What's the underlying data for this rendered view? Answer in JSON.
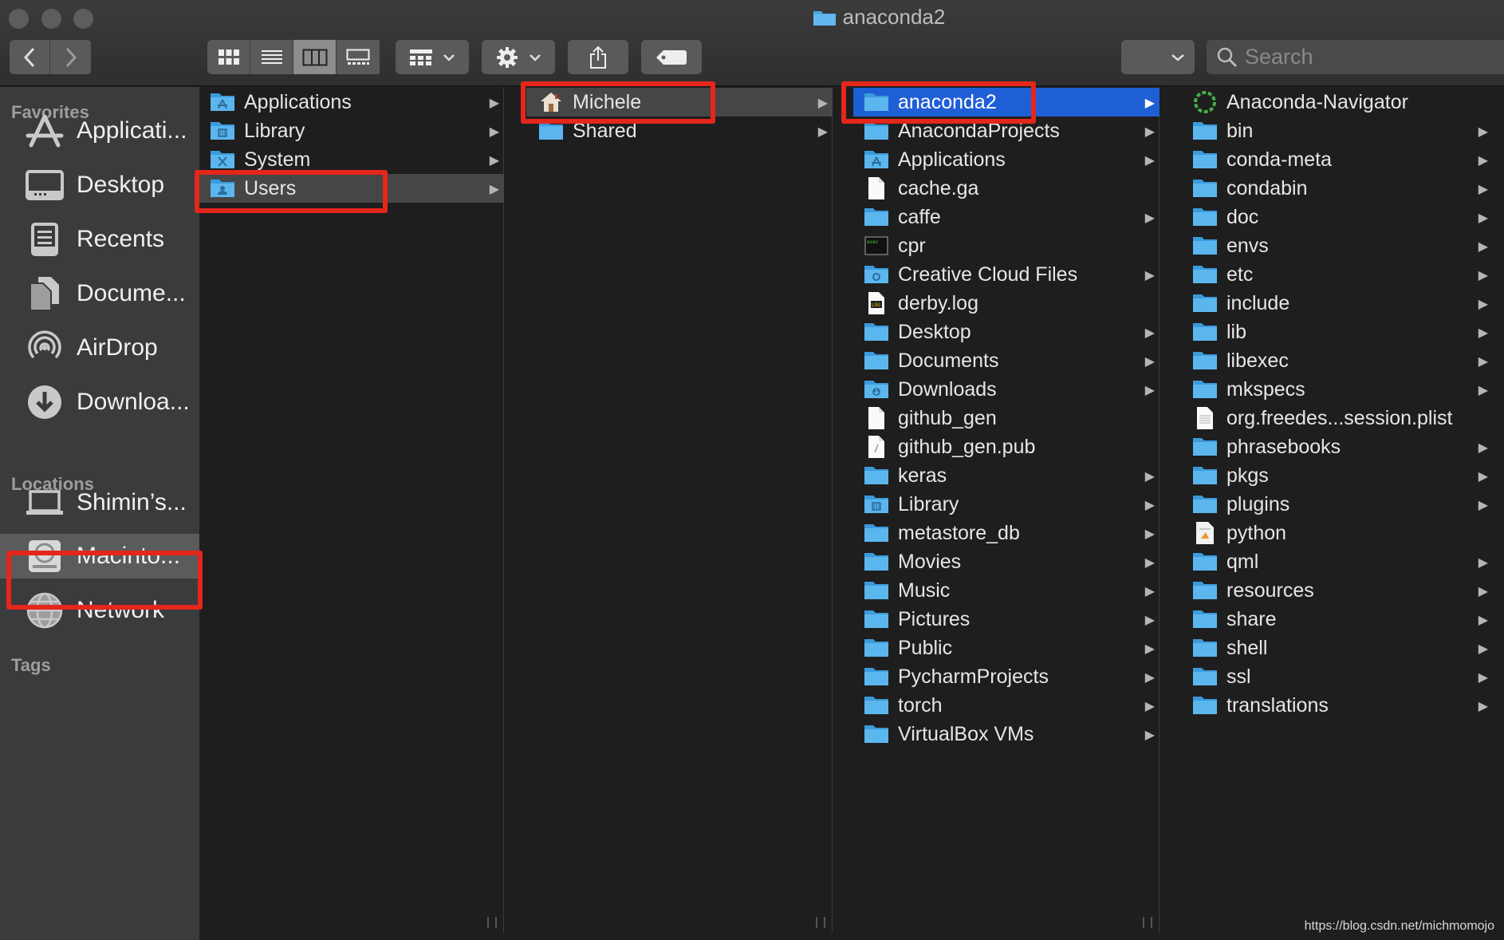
{
  "window": {
    "title": "anaconda2"
  },
  "toolbar": {
    "back_icon": "chevron-left",
    "forward_icon": "chevron-right",
    "view_modes": [
      "icon-view",
      "list-view",
      "column-view",
      "gallery-view"
    ],
    "active_view": "column-view",
    "search_placeholder": "Search"
  },
  "sidebar": {
    "favorites_header": "Favorites",
    "favorites": [
      {
        "label": "Applicati...",
        "icon": "applications-icon"
      },
      {
        "label": "Desktop",
        "icon": "desktop-icon"
      },
      {
        "label": "Recents",
        "icon": "recents-icon"
      },
      {
        "label": "Docume...",
        "icon": "documents-icon"
      },
      {
        "label": "AirDrop",
        "icon": "airdrop-icon"
      },
      {
        "label": "Downloa...",
        "icon": "downloads-icon"
      }
    ],
    "locations_header": "Locations",
    "locations": [
      {
        "label": "Shimin’s...",
        "icon": "laptop-icon"
      },
      {
        "label": "Macinto...",
        "icon": "hard-disk-icon",
        "selected": true
      },
      {
        "label": "Network",
        "icon": "network-icon"
      }
    ],
    "tags_header": "Tags"
  },
  "columns": [
    {
      "items": [
        {
          "name": "Applications",
          "type": "folder-apps",
          "arrow": true
        },
        {
          "name": "Library",
          "type": "folder-lib",
          "arrow": true
        },
        {
          "name": "System",
          "type": "folder-sys",
          "arrow": true
        },
        {
          "name": "Users",
          "type": "folder-users",
          "arrow": true,
          "state": "path"
        }
      ]
    },
    {
      "items": [
        {
          "name": "Michele",
          "type": "home",
          "arrow": true,
          "state": "path"
        },
        {
          "name": "Shared",
          "type": "folder",
          "arrow": true
        }
      ]
    },
    {
      "items": [
        {
          "name": "anaconda2",
          "type": "folder",
          "arrow": true,
          "state": "selected"
        },
        {
          "name": "AnacondaProjects",
          "type": "folder",
          "arrow": true
        },
        {
          "name": "Applications",
          "type": "folder-apps",
          "arrow": true
        },
        {
          "name": "cache.ga",
          "type": "file"
        },
        {
          "name": "caffe",
          "type": "folder",
          "arrow": true
        },
        {
          "name": "cpr",
          "type": "exec"
        },
        {
          "name": "Creative Cloud Files",
          "type": "folder-cc",
          "arrow": true
        },
        {
          "name": "derby.log",
          "type": "log"
        },
        {
          "name": "Desktop",
          "type": "folder",
          "arrow": true
        },
        {
          "name": "Documents",
          "type": "folder",
          "arrow": true
        },
        {
          "name": "Downloads",
          "type": "folder-dl",
          "arrow": true
        },
        {
          "name": "github_gen",
          "type": "file"
        },
        {
          "name": "github_gen.pub",
          "type": "file-pub"
        },
        {
          "name": "keras",
          "type": "folder",
          "arrow": true
        },
        {
          "name": "Library",
          "type": "folder-lib",
          "arrow": true
        },
        {
          "name": "metastore_db",
          "type": "folder",
          "arrow": true
        },
        {
          "name": "Movies",
          "type": "folder",
          "arrow": true
        },
        {
          "name": "Music",
          "type": "folder",
          "arrow": true
        },
        {
          "name": "Pictures",
          "type": "folder",
          "arrow": true
        },
        {
          "name": "Public",
          "type": "folder",
          "arrow": true
        },
        {
          "name": "PycharmProjects",
          "type": "folder",
          "arrow": true
        },
        {
          "name": "torch",
          "type": "folder",
          "arrow": true
        },
        {
          "name": "VirtualBox VMs",
          "type": "folder",
          "arrow": true
        }
      ]
    },
    {
      "items": [
        {
          "name": "Anaconda-Navigator",
          "type": "app-ring"
        },
        {
          "name": "bin",
          "type": "folder",
          "arrow": true
        },
        {
          "name": "conda-meta",
          "type": "folder",
          "arrow": true
        },
        {
          "name": "condabin",
          "type": "folder",
          "arrow": true
        },
        {
          "name": "doc",
          "type": "folder",
          "arrow": true
        },
        {
          "name": "envs",
          "type": "folder",
          "arrow": true
        },
        {
          "name": "etc",
          "type": "folder",
          "arrow": true
        },
        {
          "name": "include",
          "type": "folder",
          "arrow": true
        },
        {
          "name": "lib",
          "type": "folder",
          "arrow": true
        },
        {
          "name": "libexec",
          "type": "folder",
          "arrow": true
        },
        {
          "name": "mkspecs",
          "type": "folder",
          "arrow": true
        },
        {
          "name": "org.freedes...session.plist",
          "type": "plist"
        },
        {
          "name": "phrasebooks",
          "type": "folder",
          "arrow": true
        },
        {
          "name": "pkgs",
          "type": "folder",
          "arrow": true
        },
        {
          "name": "plugins",
          "type": "folder",
          "arrow": true
        },
        {
          "name": "python",
          "type": "script"
        },
        {
          "name": "qml",
          "type": "folder",
          "arrow": true
        },
        {
          "name": "resources",
          "type": "folder",
          "arrow": true
        },
        {
          "name": "share",
          "type": "folder",
          "arrow": true
        },
        {
          "name": "shell",
          "type": "folder",
          "arrow": true
        },
        {
          "name": "ssl",
          "type": "folder",
          "arrow": true
        },
        {
          "name": "translations",
          "type": "folder",
          "arrow": true
        }
      ]
    }
  ],
  "watermark": "https://blog.csdn.net/michmomojo"
}
